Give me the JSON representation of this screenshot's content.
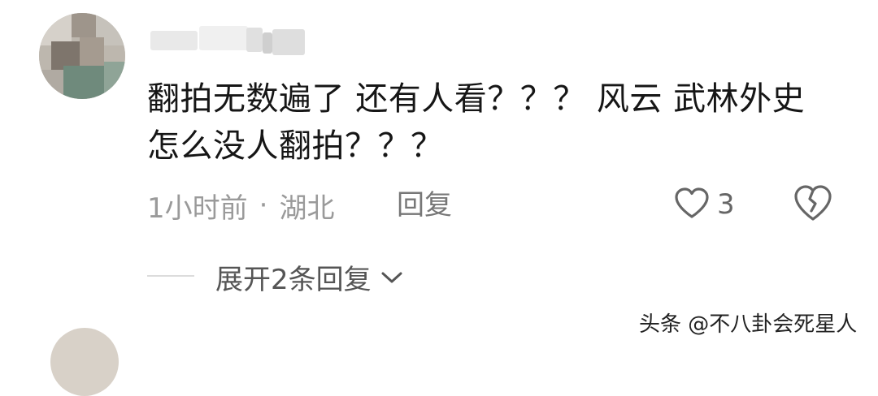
{
  "comment": {
    "text": "翻拍无数遍了 还有人看？？？ 风云 武林外史 怎么没人翻拍？？？",
    "time": "1小时前",
    "separator": "·",
    "location": "湖北",
    "reply_label": "回复",
    "like_count": "3"
  },
  "replies": {
    "expand_label": "展开2条回复"
  },
  "watermark": "头条 @不八卦会死星人",
  "colors": {
    "text": "#161616",
    "meta": "#9a9a9a",
    "icon": "#666666"
  },
  "icons": [
    "heart-icon",
    "broken-heart-icon",
    "chevron-down-icon"
  ]
}
